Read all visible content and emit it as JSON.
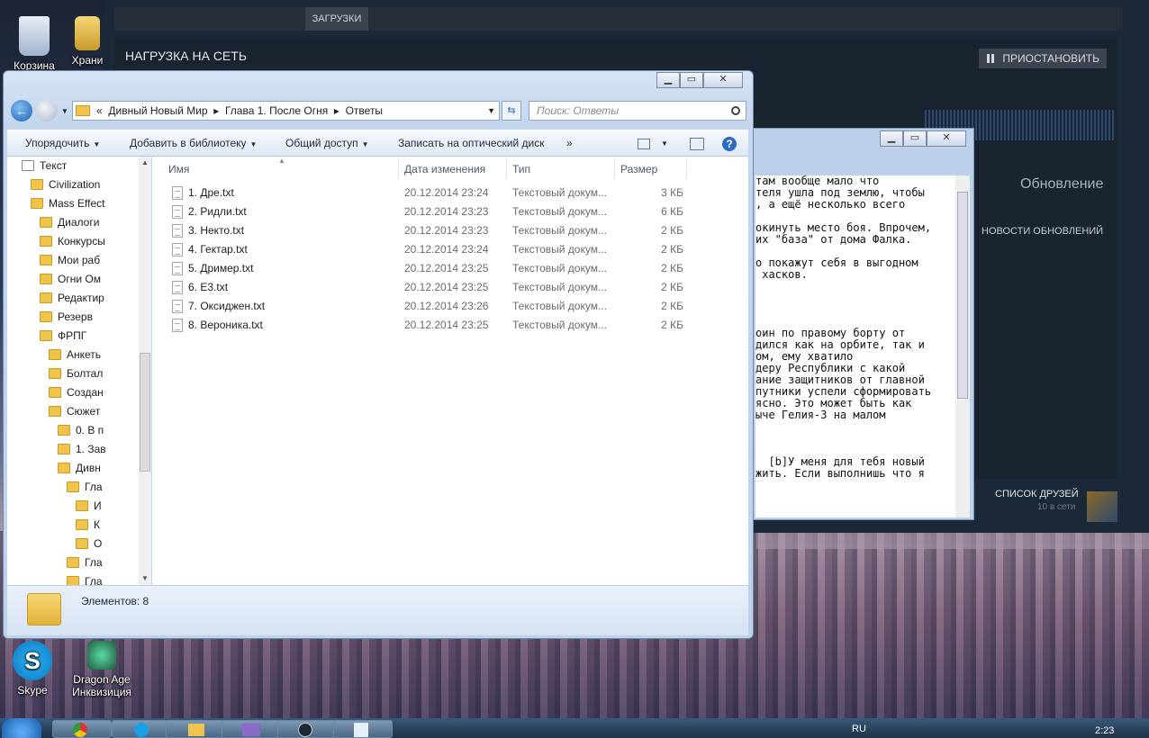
{
  "desktop": {
    "icons": [
      {
        "label": "Корзина"
      },
      {
        "label": "Храни"
      },
      {
        "label": "Skype"
      },
      {
        "label": "Dragon Age\nИнквизиция"
      }
    ]
  },
  "steam": {
    "tab_downloads": "ЗАГРУЗКИ",
    "net_title": "НАГРУЗКА НА СЕТЬ",
    "pause_label": "ПРИОСТАНОВИТЬ",
    "update_label": "Обновление",
    "news_label": "НОВОСТИ ОБНОВЛЕНИЙ",
    "friends_label": "СПИСОК ДРУЗЕЙ",
    "friends_online": "10 в сети"
  },
  "notepad": {
    "lines": [
      "там вообще мало что",
      "теля ушла под землю, чтобы",
      ", а ещё несколько всего",
      "",
      "окинуть место боя. Впрочем,",
      "их \"база\" от дома Фалка.",
      "",
      "о покажут себя в выгодном",
      " хасков.",
      "",
      "",
      "",
      "",
      "оин по правому борту от",
      "дился как на орбите, так и",
      "ом, ему хватило",
      "деру Республики с какой",
      "ание защитников от главной",
      "путники успели сформировать",
      "ясно. Это может быть как",
      "ыче Гелия-3 на малом",
      "",
      "",
      "",
      "  [b]У меня для тебя новый",
      "жить. Если выполнишь что я"
    ]
  },
  "explorer": {
    "address": {
      "chevron": "«",
      "crumbs": [
        "Дивный Новый Мир",
        "Глава 1. После Огня",
        "Ответы"
      ],
      "sep": "▸"
    },
    "search_placeholder": "Поиск: Ответы",
    "toolbar": {
      "organize": "Упорядочить",
      "add_library": "Добавить в библиотеку",
      "share": "Общий доступ",
      "burn": "Записать на оптический диск",
      "more": "»"
    },
    "tree": [
      {
        "label": "Текст",
        "indent": 2,
        "type": "page"
      },
      {
        "label": "Civilization",
        "indent": 3,
        "type": "folder"
      },
      {
        "label": "Mass Effect",
        "indent": 3,
        "type": "folder"
      },
      {
        "label": "Диалоги",
        "indent": 4,
        "type": "folder"
      },
      {
        "label": "Конкурсы",
        "indent": 4,
        "type": "folder"
      },
      {
        "label": "Мои раб",
        "indent": 4,
        "type": "folder"
      },
      {
        "label": "Огни Ом",
        "indent": 4,
        "type": "folder"
      },
      {
        "label": "Редактир",
        "indent": 4,
        "type": "folder"
      },
      {
        "label": "Резерв",
        "indent": 4,
        "type": "folder"
      },
      {
        "label": "ФРПГ",
        "indent": 4,
        "type": "folder"
      },
      {
        "label": "Анкеть",
        "indent": 5,
        "type": "folder"
      },
      {
        "label": "Болтал",
        "indent": 5,
        "type": "folder"
      },
      {
        "label": "Создан",
        "indent": 5,
        "type": "folder"
      },
      {
        "label": "Сюжет",
        "indent": 5,
        "type": "folder"
      },
      {
        "label": "0. В п",
        "indent": 6,
        "type": "folder"
      },
      {
        "label": "1. Зав",
        "indent": 6,
        "type": "folder"
      },
      {
        "label": "Дивн",
        "indent": 6,
        "type": "folder"
      },
      {
        "label": "Гла",
        "indent": 7,
        "type": "folder"
      },
      {
        "label": "И",
        "indent": 8,
        "type": "folder"
      },
      {
        "label": "К",
        "indent": 8,
        "type": "folder"
      },
      {
        "label": "О",
        "indent": 8,
        "type": "folder"
      },
      {
        "label": "Гла",
        "indent": 7,
        "type": "folder"
      },
      {
        "label": "Гла",
        "indent": 7,
        "type": "folder"
      }
    ],
    "columns": {
      "name": "Имя",
      "date": "Дата изменения",
      "type": "Тип",
      "size": "Размер"
    },
    "files": [
      {
        "name": "1. Дре.txt",
        "date": "20.12.2014 23:24",
        "type": "Текстовый докум...",
        "size": "3 КБ"
      },
      {
        "name": "2. Ридли.txt",
        "date": "20.12.2014 23:23",
        "type": "Текстовый докум...",
        "size": "6 КБ"
      },
      {
        "name": "3. Некто.txt",
        "date": "20.12.2014 23:23",
        "type": "Текстовый докум...",
        "size": "2 КБ"
      },
      {
        "name": "4. Гектар.txt",
        "date": "20.12.2014 23:24",
        "type": "Текстовый докум...",
        "size": "2 КБ"
      },
      {
        "name": "5. Дример.txt",
        "date": "20.12.2014 23:25",
        "type": "Текстовый докум...",
        "size": "2 КБ"
      },
      {
        "name": "6. E3.txt",
        "date": "20.12.2014 23:25",
        "type": "Текстовый докум...",
        "size": "2 КБ"
      },
      {
        "name": "7. Оксиджен.txt",
        "date": "20.12.2014 23:26",
        "type": "Текстовый докум...",
        "size": "2 КБ"
      },
      {
        "name": "8. Вероника.txt",
        "date": "20.12.2014 23:25",
        "type": "Текстовый докум...",
        "size": "2 КБ"
      }
    ],
    "status_count": "Элементов: 8"
  },
  "taskbar": {
    "lang": "RU",
    "clock": "2:23"
  }
}
